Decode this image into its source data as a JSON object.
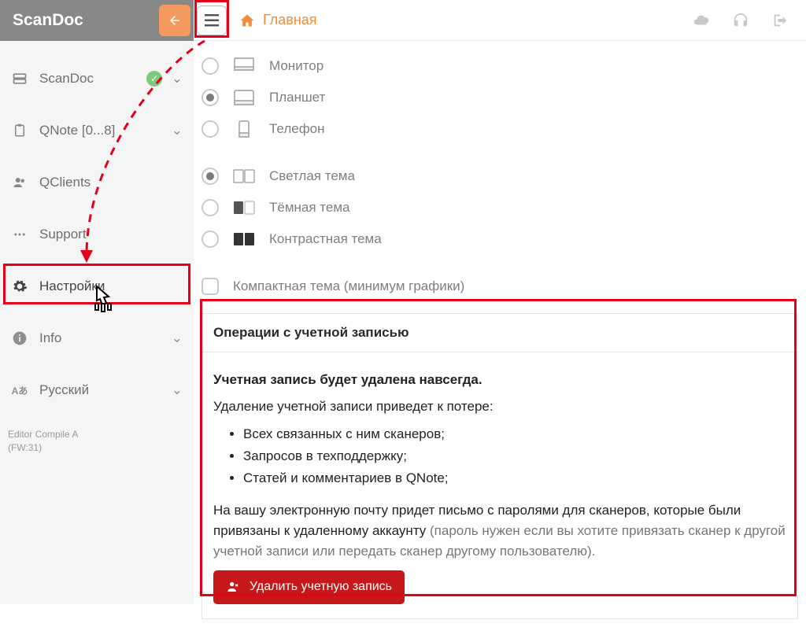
{
  "brand": "ScanDoc",
  "breadcrumb": {
    "home": "Главная"
  },
  "sidebar": {
    "items": [
      {
        "label": "ScanDoc",
        "icon": "drive-icon",
        "check": true,
        "chev": true
      },
      {
        "label": "QNote [0...8]",
        "icon": "clipboard-icon",
        "check": false,
        "chev": true
      },
      {
        "label": "QClients",
        "icon": "users-icon",
        "check": false,
        "chev": false
      },
      {
        "label": "Support",
        "icon": "support-icon",
        "check": false,
        "chev": false
      },
      {
        "label": "Настройки",
        "icon": "gear-icon",
        "check": false,
        "chev": false
      },
      {
        "label": "Info",
        "icon": "info-icon",
        "check": false,
        "chev": true
      },
      {
        "label": "Русский",
        "icon": "language-icon",
        "check": false,
        "chev": true
      }
    ]
  },
  "footer": {
    "line1": "Editor Compile A",
    "line2": "(FW:31)"
  },
  "view_mode": {
    "options": [
      {
        "label": "Монитор",
        "checked": false,
        "icon": "monitor-icon"
      },
      {
        "label": "Планшет",
        "checked": true,
        "icon": "tablet-icon"
      },
      {
        "label": "Телефон",
        "checked": false,
        "icon": "phone-icon"
      }
    ]
  },
  "theme": {
    "options": [
      {
        "label": "Светлая тема",
        "checked": true,
        "icon": "theme-light-icon"
      },
      {
        "label": "Тёмная тема",
        "checked": false,
        "icon": "theme-dark-icon"
      },
      {
        "label": "Контрастная тема",
        "checked": false,
        "icon": "theme-contrast-icon"
      }
    ],
    "compact_label": "Компактная тема (минимум графики)"
  },
  "account": {
    "title": "Операции с учетной записью",
    "lead": "Учетная запись будет удалена навсегда.",
    "intro": "Удаление учетной записи приведет к потере:",
    "bullets": [
      "Всех связанных с ним сканеров;",
      "Запросов в техподдержку;",
      "Статей и комментариев в QNote;"
    ],
    "note_main": "На вашу электронную почту придет письмо с паролями для сканеров, которые были привязаны к удаленному аккаунту ",
    "note_grey": "(пароль нужен если вы хотите привязать сканер к другой учетной записи или передать сканер другому пользователю).",
    "delete_label": "Удалить учетную запись"
  },
  "colors": {
    "accent_orange": "#f28c3a",
    "danger": "#c6171b",
    "highlight": "#e2001a"
  }
}
